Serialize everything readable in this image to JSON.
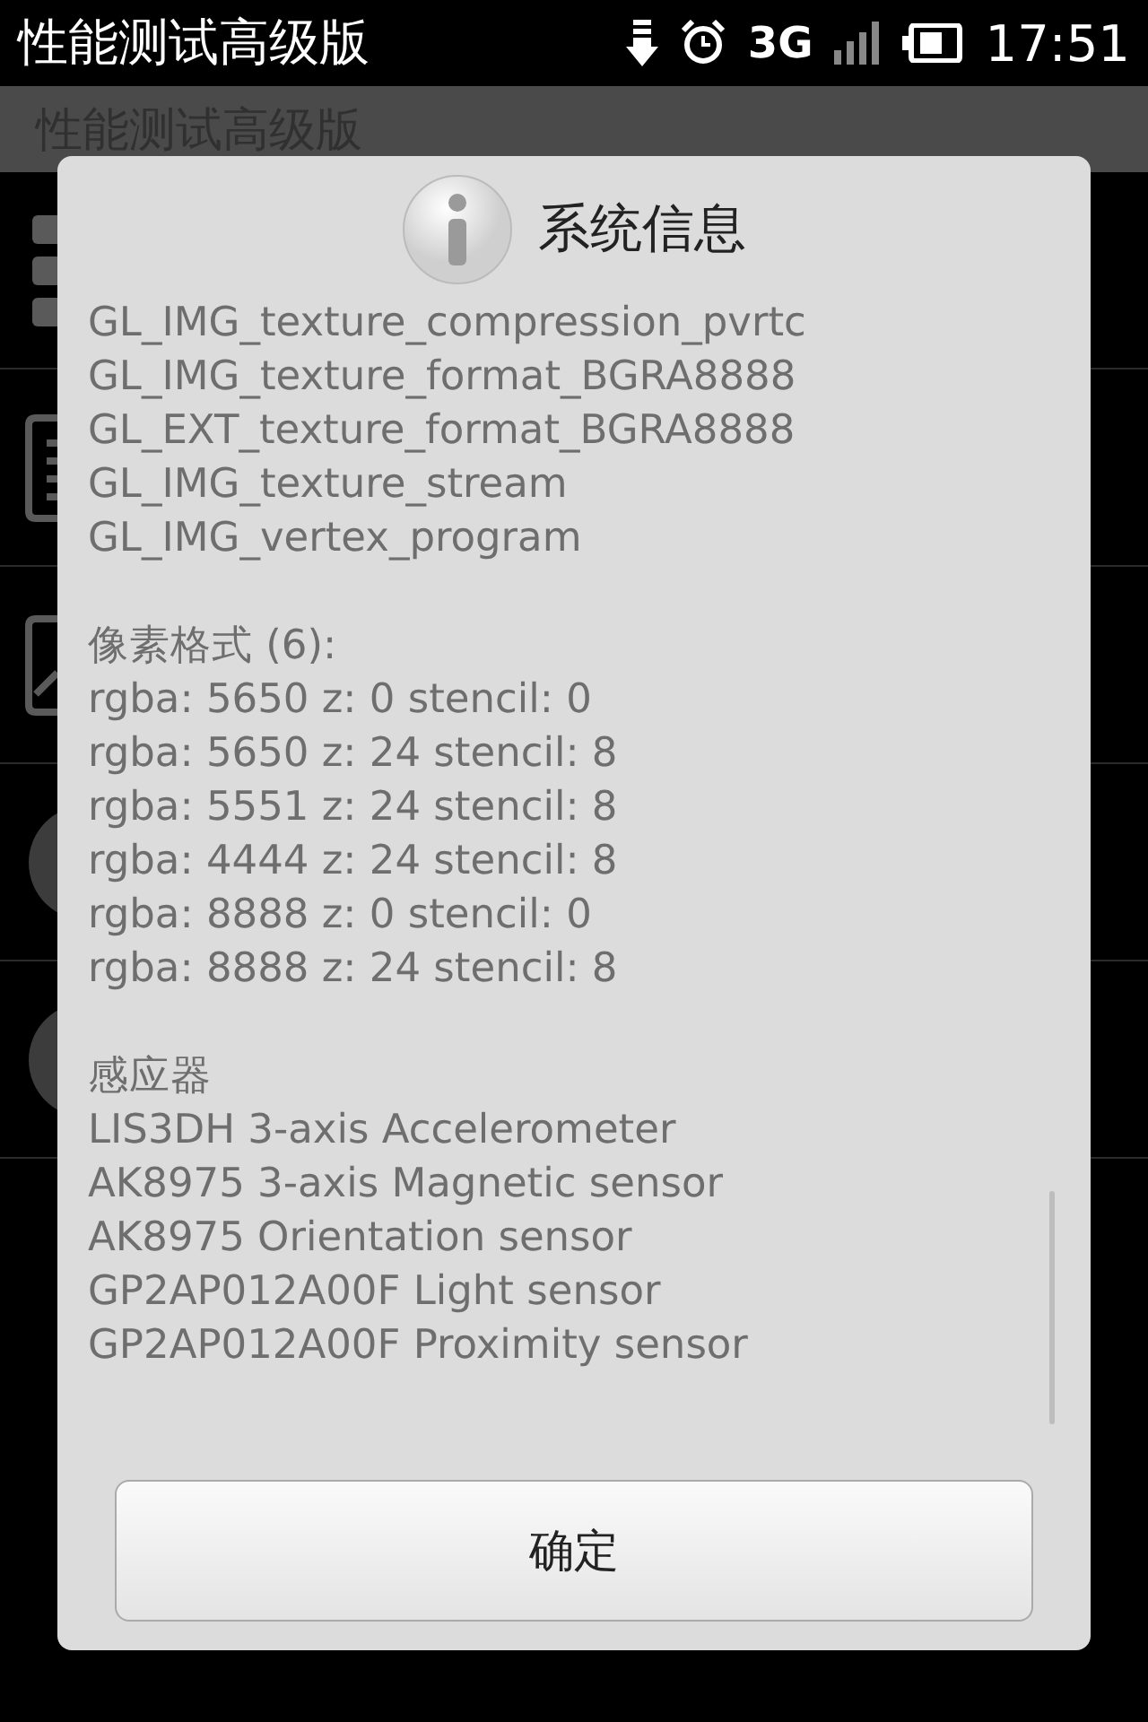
{
  "status_bar": {
    "app_title": "性能测试高级版",
    "network": "3G",
    "time": "17:51"
  },
  "app_bar": {
    "title": "性能测试高级版"
  },
  "dialog": {
    "title": "系统信息",
    "sections": [
      {
        "lines": [
          "GL_IMG_texture_compression_pvrtc",
          "GL_IMG_texture_format_BGRA8888",
          "GL_EXT_texture_format_BGRA8888",
          "GL_IMG_texture_stream",
          "GL_IMG_vertex_program"
        ]
      },
      {
        "heading": "像素格式 (6):",
        "lines": [
          "rgba: 5650 z: 0 stencil: 0",
          "rgba: 5650 z: 24 stencil: 8",
          "rgba: 5551 z: 24 stencil: 8",
          "rgba: 4444 z: 24 stencil: 8",
          "rgba: 8888 z: 0 stencil: 0",
          "rgba: 8888 z: 24 stencil: 8"
        ]
      },
      {
        "heading": "感应器",
        "lines": [
          "LIS3DH 3-axis Accelerometer",
          "AK8975 3-axis Magnetic sensor",
          "AK8975 Orientation sensor",
          "GP2AP012A00F Light sensor",
          "GP2AP012A00F Proximity sensor"
        ]
      }
    ],
    "button": "确定"
  }
}
